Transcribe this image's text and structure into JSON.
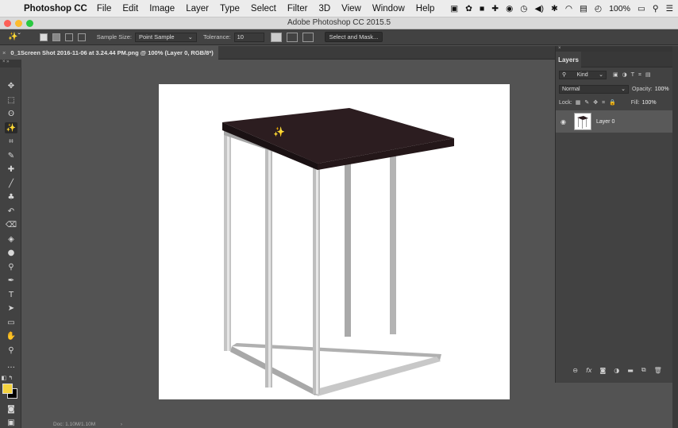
{
  "menubar": {
    "app_name": "Photoshop CC",
    "items": [
      "File",
      "Edit",
      "Image",
      "Layer",
      "Type",
      "Select",
      "Filter",
      "3D",
      "View",
      "Window",
      "Help"
    ],
    "battery": "100%"
  },
  "window": {
    "title": "Adobe Photoshop CC 2015.5"
  },
  "options": {
    "sample_size_label": "Sample Size:",
    "sample_size_value": "Point Sample",
    "tolerance_label": "Tolerance:",
    "tolerance_value": "10",
    "select_mask_label": "Select and Mask..."
  },
  "document": {
    "tab_title": "0_1Screen Shot 2016-11-06 at 3.24.44 PM.png @ 100% (Layer 0, RGB/8*)",
    "tab_close": "×"
  },
  "status": {
    "doc_size": "Doc: 1.10M/1.10M"
  },
  "colors": {
    "foreground": "#f4d23e",
    "background": "#000000"
  },
  "layers_panel": {
    "tab_label": "Layers",
    "filter_label": "Kind",
    "blend_mode": "Normal",
    "opacity_label": "Opacity:",
    "opacity_value": "100%",
    "lock_label": "Lock:",
    "fill_label": "Fill:",
    "fill_value": "100%",
    "layers": [
      {
        "name": "Layer 0",
        "visible": true
      }
    ]
  }
}
